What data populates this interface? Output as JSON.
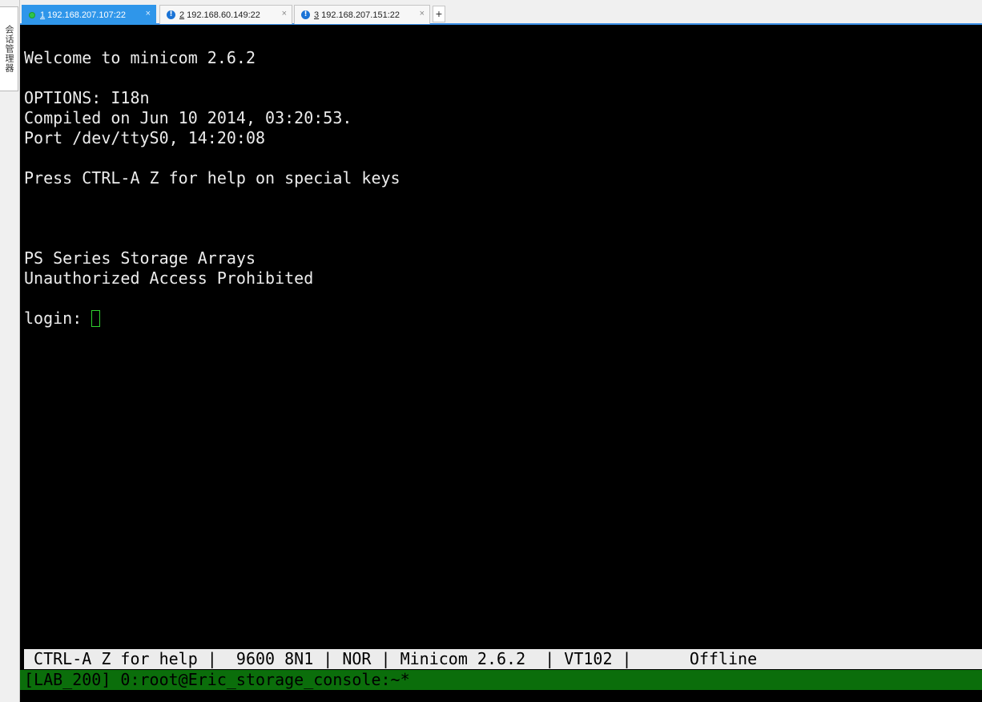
{
  "sidebar": {
    "label": "会话管理器"
  },
  "tabs": [
    {
      "num": "1",
      "label": "192.168.207.107:22",
      "status": "connected",
      "close": "×"
    },
    {
      "num": "2",
      "label": "192.168.60.149:22",
      "status": "warning",
      "close": "×"
    },
    {
      "num": "3",
      "label": "192.168.207.151:22",
      "status": "warning",
      "close": "×"
    }
  ],
  "add_tab": "+",
  "terminal": {
    "lines": [
      "Welcome to minicom 2.6.2",
      "OPTIONS: I18n",
      "Compiled on Jun 10 2014, 03:20:53.",
      "Port /dev/ttyS0, 14:20:08",
      "Press CTRL-A Z for help on special keys",
      "PS Series Storage Arrays",
      "Unauthorized Access Prohibited",
      "login: "
    ],
    "status_bar": " CTRL-A Z for help |  9600 8N1 | NOR | Minicom 2.6.2  | VT102 |      Offline",
    "tmux_bar": "[LAB_200] 0:root@Eric_storage_console:~*"
  }
}
